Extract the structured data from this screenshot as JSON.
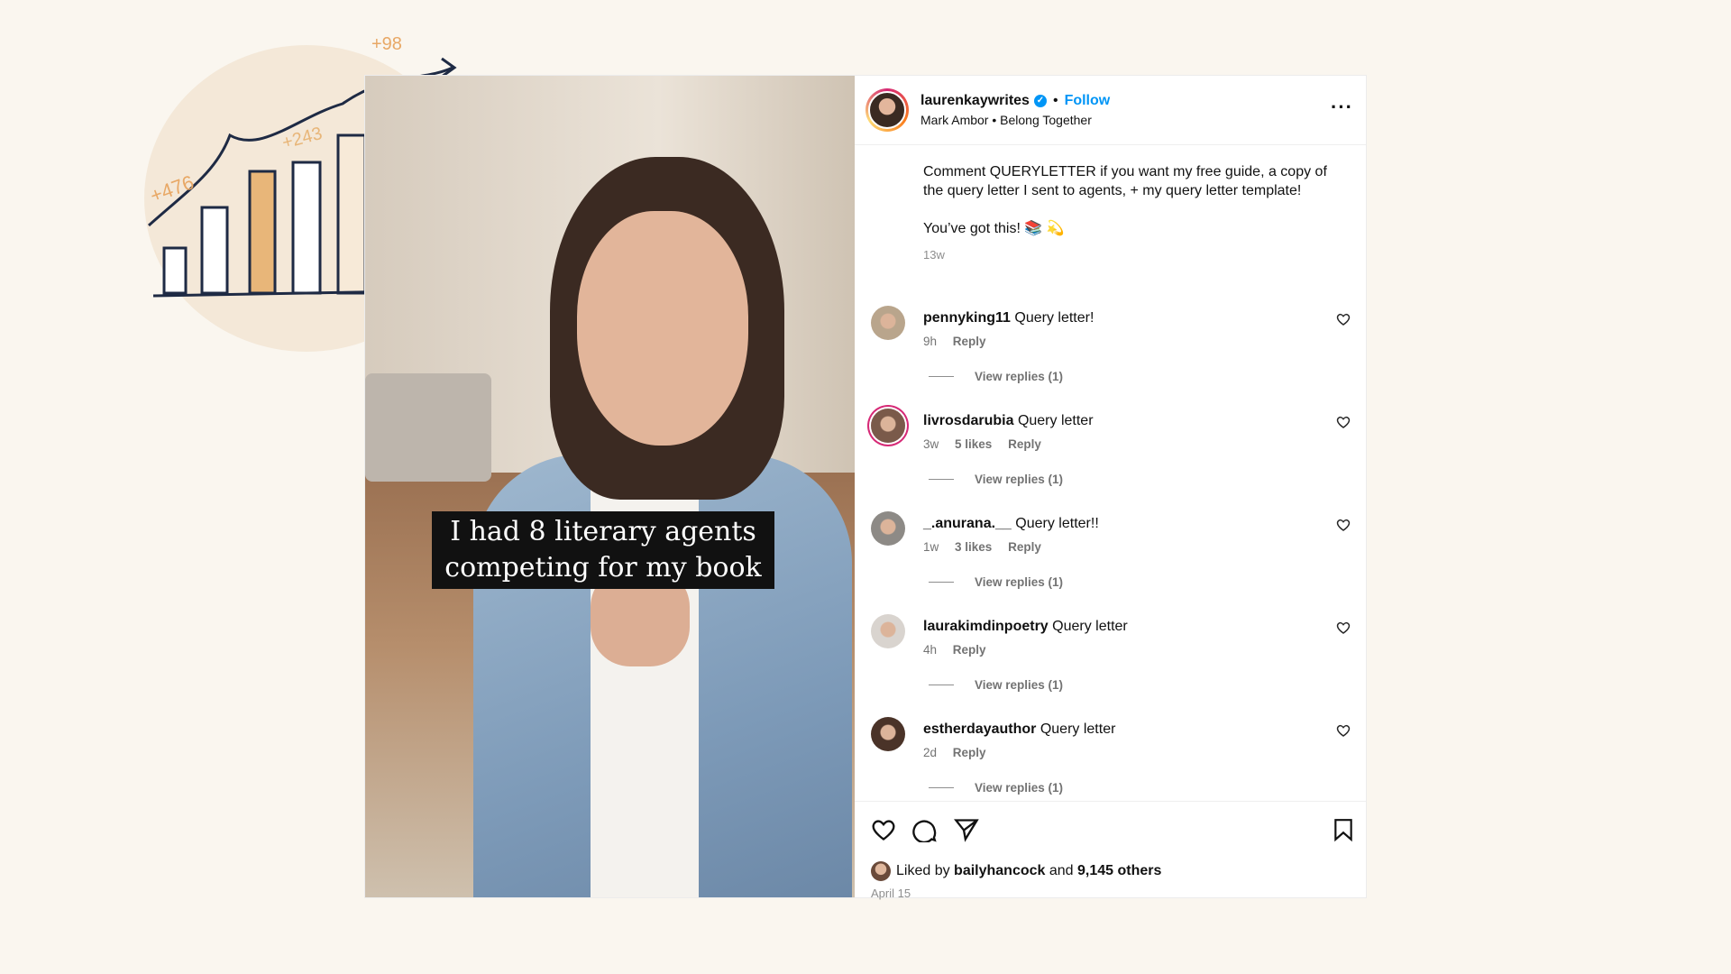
{
  "doodle": {
    "labels": [
      "+476",
      "+243",
      "+98"
    ]
  },
  "media": {
    "overlay_line1": "I had 8 literary agents",
    "overlay_line2": "competing for my book"
  },
  "header": {
    "username": "laurenkaywrites",
    "verified_icon": "verified-badge",
    "follow_label": "Follow",
    "audio_artist": "Mark Ambor",
    "audio_title": "Belong Together",
    "more_icon": "more-horizontal"
  },
  "caption": {
    "text": "Comment QUERYLETTER if you want my free guide, a copy of the query letter I sent to agents, + my query letter template!",
    "text2": "You’ve got this! 📚 💫",
    "time": "13w"
  },
  "comments": [
    {
      "user": "pennyking11",
      "text": "Query letter!",
      "time": "9h",
      "likes": "",
      "reply": "Reply",
      "view_replies": "View replies (1)",
      "avatar_color": "#b9a58c"
    },
    {
      "user": "livrosdarubia",
      "text": "Query letter",
      "time": "3w",
      "likes": "5 likes",
      "reply": "Reply",
      "view_replies": "View replies (1)",
      "avatar_color": "#7a5a4a"
    },
    {
      "user": "_.anurana.__",
      "text": "Query letter!!",
      "time": "1w",
      "likes": "3 likes",
      "reply": "Reply",
      "view_replies": "View replies (1)",
      "avatar_color": "#8d8a86"
    },
    {
      "user": "laurakimdinpoetry",
      "text": "Query letter",
      "time": "4h",
      "likes": "",
      "reply": "Reply",
      "view_replies": "View replies (1)",
      "avatar_color": "#d9d4cf"
    },
    {
      "user": "estherdayauthor",
      "text": "Query letter",
      "time": "2d",
      "likes": "",
      "reply": "Reply",
      "view_replies": "View replies (1)",
      "avatar_color": "#4a3328"
    }
  ],
  "footer": {
    "liked_prefix": "Liked by",
    "liked_user": "bailyhancock",
    "liked_and": "and",
    "liked_count": "9,145 others",
    "date": "April 15"
  },
  "colors": {
    "accent": "#0095f6",
    "background": "#faf6ef",
    "doodle_bar": "#e8b679",
    "doodle_ink": "#1e2a44"
  }
}
